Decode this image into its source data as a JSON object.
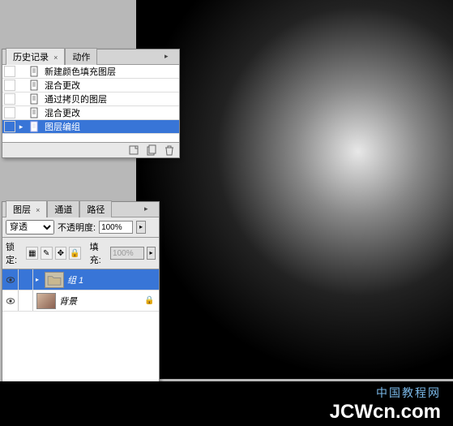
{
  "history_panel": {
    "tabs": [
      {
        "label": "历史记录",
        "active": true
      },
      {
        "label": "动作",
        "active": false
      }
    ],
    "items": [
      {
        "icon": "doc",
        "label": "新建颜色填充图层",
        "selected": false,
        "marker": ""
      },
      {
        "icon": "doc",
        "label": "混合更改",
        "selected": false,
        "marker": ""
      },
      {
        "icon": "doc",
        "label": "通过拷贝的图层",
        "selected": false,
        "marker": ""
      },
      {
        "icon": "doc",
        "label": "混合更改",
        "selected": false,
        "marker": ""
      },
      {
        "icon": "doc",
        "label": "图层编组",
        "selected": true,
        "marker": "▸"
      }
    ]
  },
  "layers_panel": {
    "tabs": [
      {
        "label": "图层",
        "active": true
      },
      {
        "label": "通道",
        "active": false
      },
      {
        "label": "路径",
        "active": false
      }
    ],
    "blend_mode": "穿透",
    "opacity_label": "不透明度:",
    "opacity_value": "100%",
    "lock_label": "锁定:",
    "fill_label": "填充:",
    "fill_value": "100%",
    "layers": [
      {
        "name": "组 1",
        "type": "folder",
        "selected": true,
        "visible": true,
        "locked": false
      },
      {
        "name": "背景",
        "type": "image",
        "selected": false,
        "visible": true,
        "locked": true
      }
    ]
  },
  "watermark": {
    "cn": "中国教程网",
    "en": "JCWcn.com"
  }
}
